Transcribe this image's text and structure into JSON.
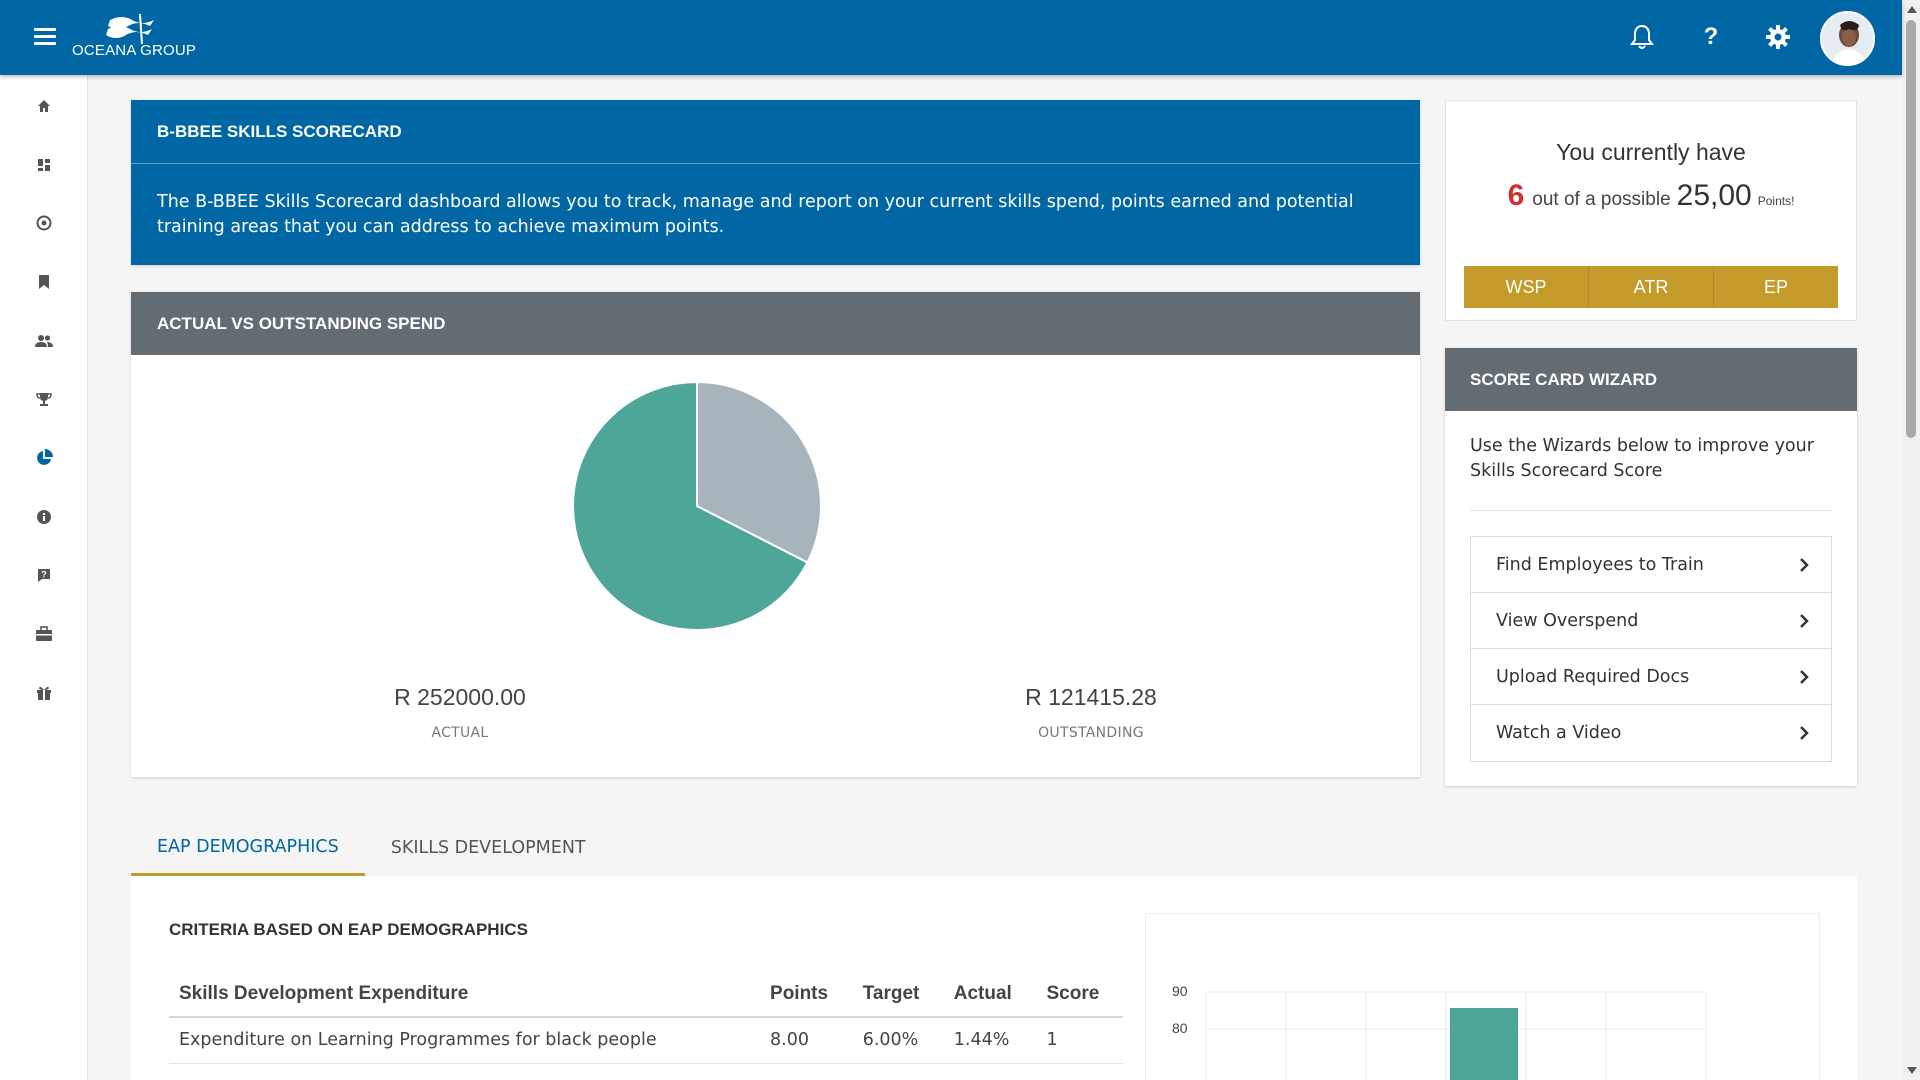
{
  "header": {
    "logo_text": "OCEANA GROUP"
  },
  "icons": {
    "menu": "hamburger-icon",
    "notifications": "bell-icon",
    "help": "question-icon",
    "settings": "gear-icon"
  },
  "sidebar": {
    "items": [
      {
        "name": "home",
        "icon": "home-icon"
      },
      {
        "name": "dashboard",
        "icon": "dashboard-icon"
      },
      {
        "name": "explore",
        "icon": "compass-icon"
      },
      {
        "name": "bookmarks",
        "icon": "bookmark-icon"
      },
      {
        "name": "people",
        "icon": "people-icon"
      },
      {
        "name": "awards",
        "icon": "trophy-icon"
      },
      {
        "name": "scorecard",
        "icon": "pie-chart-icon",
        "active": true
      },
      {
        "name": "info",
        "icon": "info-icon"
      },
      {
        "name": "help",
        "icon": "help-icon"
      },
      {
        "name": "work",
        "icon": "briefcase-icon"
      },
      {
        "name": "rewards",
        "icon": "gift-icon"
      }
    ]
  },
  "intro": {
    "title": "B-BBEE SKILLS SCORECARD",
    "description": "The B-BBEE Skills Scorecard dashboard allows you to track, manage and report on your current skills spend, points earned and potential training areas that you can address to achieve maximum points."
  },
  "spend": {
    "title": "ACTUAL VS OUTSTANDING SPEND",
    "actual_amount": "R 252000.00",
    "actual_label": "ACTUAL",
    "outstanding_amount": "R 121415.28",
    "outstanding_label": "OUTSTANDING",
    "pie": {
      "actual_value": 252000.0,
      "outstanding_value": 121415.28,
      "actual_color": "#4ea699",
      "outstanding_color": "#a8b4bc"
    }
  },
  "points": {
    "title": "You currently have",
    "current": "6",
    "middle_text": "out of a possible",
    "maximum": "25,00",
    "suffix": "Points!",
    "buttons": [
      "WSP",
      "ATR",
      "EP"
    ]
  },
  "wizard": {
    "title": "SCORE CARD WIZARD",
    "description": "Use the Wizards below to improve your Skills Scorecard Score",
    "items": [
      "Find Employees to Train",
      "View Overspend",
      "Upload Required Docs",
      "Watch a Video"
    ]
  },
  "tabs": [
    {
      "label": "EAP DEMOGRAPHICS",
      "active": true
    },
    {
      "label": "SKILLS DEVELOPMENT",
      "active": false
    }
  ],
  "criteria": {
    "title": "CRITERIA BASED ON EAP DEMOGRAPHICS",
    "headers": [
      "Skills Development Expenditure",
      "Points",
      "Target",
      "Actual",
      "Score"
    ],
    "rows": [
      [
        "Expenditure on Learning Programmes for black people",
        "8.00",
        "6.00%",
        "1.44%",
        "1"
      ]
    ]
  },
  "bar_chart": {
    "y_ticks": [
      "90",
      "80"
    ],
    "bar_color": "#4ea699"
  },
  "colors": {
    "primary": "#0066a4",
    "accent_gold": "#c49a2b",
    "panel_gray": "#636b73",
    "points_red": "#d32f2f"
  }
}
